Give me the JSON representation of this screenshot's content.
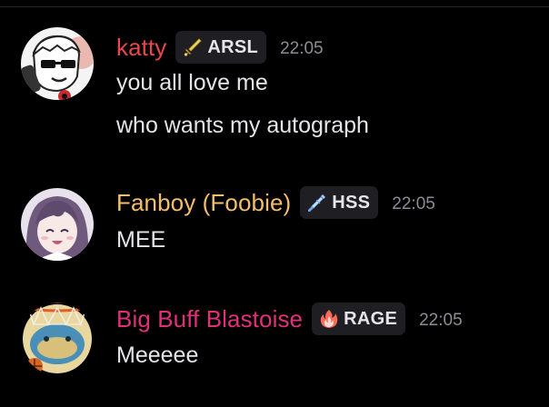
{
  "colors": {
    "background": "#000000",
    "tag_background": "#1f1f23",
    "timestamp": "#8c8c94",
    "message_text": "#e4e4e8"
  },
  "messages": [
    {
      "username": "katty",
      "username_color": "#e8474c",
      "tag": {
        "icon": "sword-icon",
        "label": "ARSL"
      },
      "timestamp": "22:05",
      "lines": [
        "you all love me",
        "who wants my autograph"
      ]
    },
    {
      "username": "Fanboy (Foobie)",
      "username_color": "#f5bd6e",
      "tag": {
        "icon": "syringe-icon",
        "label": "HSS"
      },
      "timestamp": "22:05",
      "lines": [
        "MEE"
      ]
    },
    {
      "username": "Big Buff Blastoise",
      "username_color": "#e0307a",
      "tag": {
        "icon": "flame-icon",
        "label": "RAGE"
      },
      "timestamp": "22:05",
      "lines": [
        "Meeeee"
      ]
    }
  ]
}
